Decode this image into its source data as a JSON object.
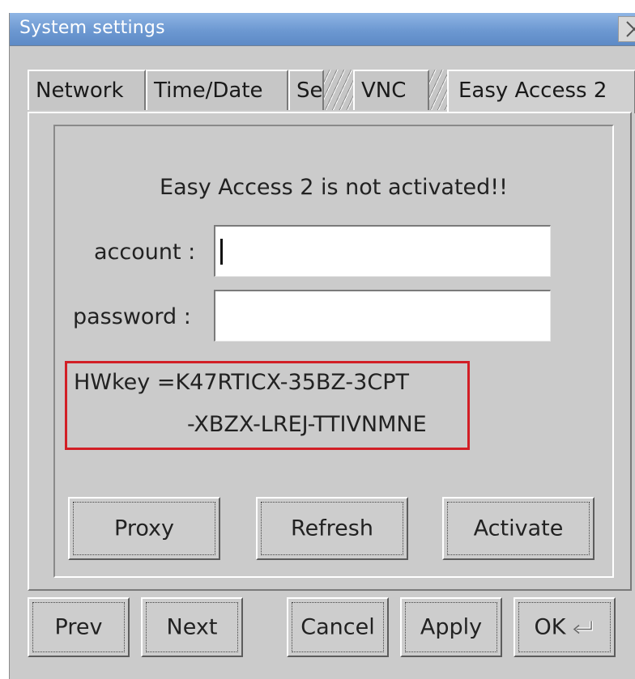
{
  "window": {
    "title": "System settings"
  },
  "tabs": [
    {
      "label": "Network"
    },
    {
      "label": "Time/Date"
    },
    {
      "label": "Se"
    },
    {
      "label": "VNC"
    },
    {
      "label": "Easy Access 2"
    }
  ],
  "panel": {
    "status": "Easy Access 2 is not activated!!",
    "account_label": "account :",
    "account_value": "",
    "password_label": "password :",
    "password_value": "",
    "hwkey_line1": "HWkey =K47RTICX-35BZ-3CPT",
    "hwkey_line2": "-XBZX-LREJ-TTIVNMNE",
    "buttons": {
      "proxy": "Proxy",
      "refresh": "Refresh",
      "activate": "Activate"
    }
  },
  "footer": {
    "prev": "Prev",
    "next": "Next",
    "cancel": "Cancel",
    "apply": "Apply",
    "ok": "OK"
  },
  "icons": {
    "close": "close-icon",
    "enter": "enter-icon"
  },
  "colors": {
    "titlebar": "#6c98d1",
    "hwkey_border": "#d21f26",
    "window_bg": "#cbcbcb"
  }
}
